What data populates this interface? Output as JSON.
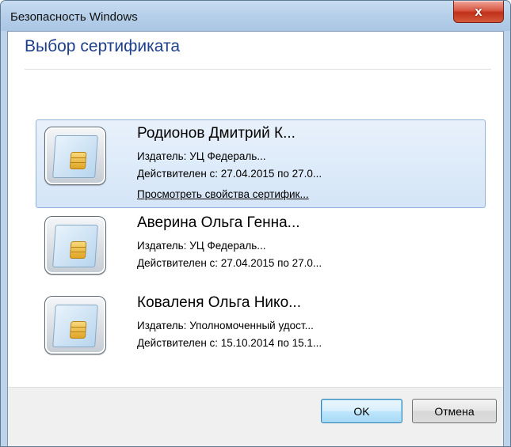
{
  "window": {
    "title": "Безопасность Windows",
    "close_label": "x"
  },
  "dialog": {
    "heading": "Выбор сертификата"
  },
  "certificates": [
    {
      "name": "Родионов Дмитрий К...",
      "issuer": "Издатель: УЦ Федераль...",
      "validity": "Действителен с: 27.04.2015 по 27.0...",
      "link": "Просмотреть свойства сертифик...",
      "selected": true
    },
    {
      "name": "Аверина Ольга Генна...",
      "issuer": "Издатель:   УЦ Федераль...",
      "validity": "Действителен с: 27.04.2015 по 27.0...",
      "selected": false
    },
    {
      "name": "Коваленя Ольга Нико...",
      "issuer": "Издатель: Уполномоченный удост...",
      "validity": "Действителен с: 15.10.2014 по 15.1...",
      "selected": false
    }
  ],
  "buttons": {
    "ok": "OK",
    "cancel": "Отмена"
  },
  "colors": {
    "heading": "#1e3f8c",
    "selection_bg": "#d4e5f7",
    "selection_border": "#8fb3da",
    "close_button": "#c1301a"
  },
  "icons": {
    "certificate": "smart-card-certificate-icon",
    "close": "close-icon"
  }
}
